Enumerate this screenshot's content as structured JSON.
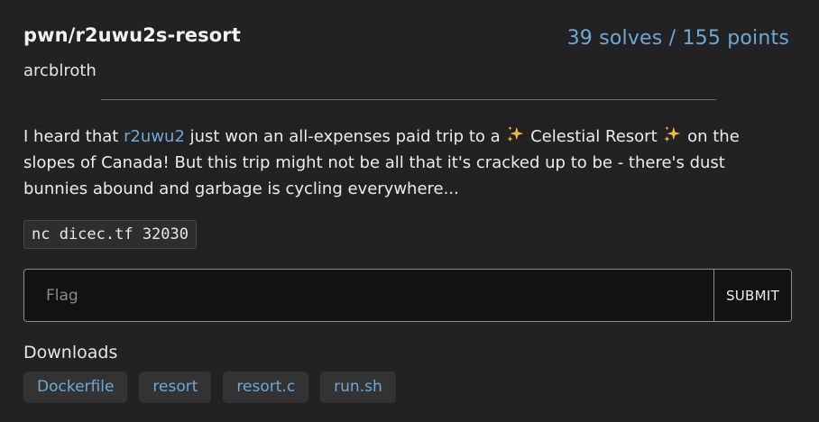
{
  "challenge": {
    "title": "pwn/r2uwu2s-resort",
    "stats": "39 solves / 155 points",
    "author": "arcblroth"
  },
  "description": {
    "part1": "I heard that ",
    "link_text": "r2uwu2",
    "part2": " just won an all-expenses paid trip to a ",
    "part3": " Celestial Resort ",
    "part4": " on the slopes of Canada! But this trip might not be all that it's cracked up to be - there's dust bunnies abound and garbage is cycling everywhere..."
  },
  "connection": {
    "command": "nc dicec.tf 32030"
  },
  "flag_form": {
    "placeholder": "Flag",
    "value": "",
    "submit_label": "SUBMIT"
  },
  "downloads": {
    "label": "Downloads",
    "files": [
      "Dockerfile",
      "resort",
      "resort.c",
      "run.sh"
    ]
  },
  "colors": {
    "background": "#222222",
    "accent_link": "#6ea8d8",
    "sparkle": "#f5b83a"
  },
  "icons": {
    "sparkle": "sparkles-icon"
  }
}
